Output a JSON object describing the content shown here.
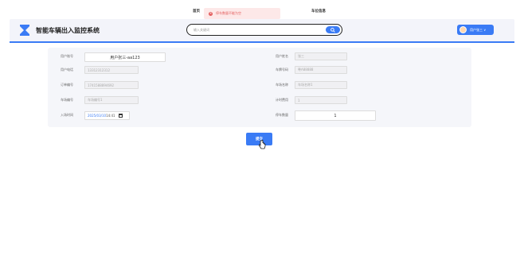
{
  "nav": {
    "home": "首页",
    "parking_info": "车位信息"
  },
  "toast": {
    "message": "停车数量不能为空"
  },
  "header": {
    "title": "智能车辆出入监控系统",
    "search_placeholder": "输入关键词",
    "user_label": "用户张三 ∨"
  },
  "form": {
    "user_id_label": "用户账号",
    "user_id_value": "用户张三-aa123",
    "user_name_label": "用户姓名",
    "user_name_value": "张三",
    "phone_label": "用户电话",
    "phone_value": "13312312312",
    "plate_label": "车牌号码",
    "plate_value": "粤A88888",
    "order_label": "订单编号",
    "order_value": "1741588894692",
    "lot_name_label": "车场名称",
    "lot_name_value": "车场名称1",
    "lot_no_label": "车场编号",
    "lot_no_value": "车场编号1",
    "fee_label": "计时费用",
    "fee_value": "1",
    "entry_time_label": "入场时间",
    "entry_date_a": "2025/",
    "entry_date_b": "03/10",
    "entry_time_value": " 14:41",
    "park_count_label": "停车数量",
    "park_count_value": "1"
  },
  "submit_label": "提交",
  "colors": {
    "accent": "#3a7bf5",
    "error": "#e25a5a",
    "header_bg": "#f3f4fa"
  }
}
